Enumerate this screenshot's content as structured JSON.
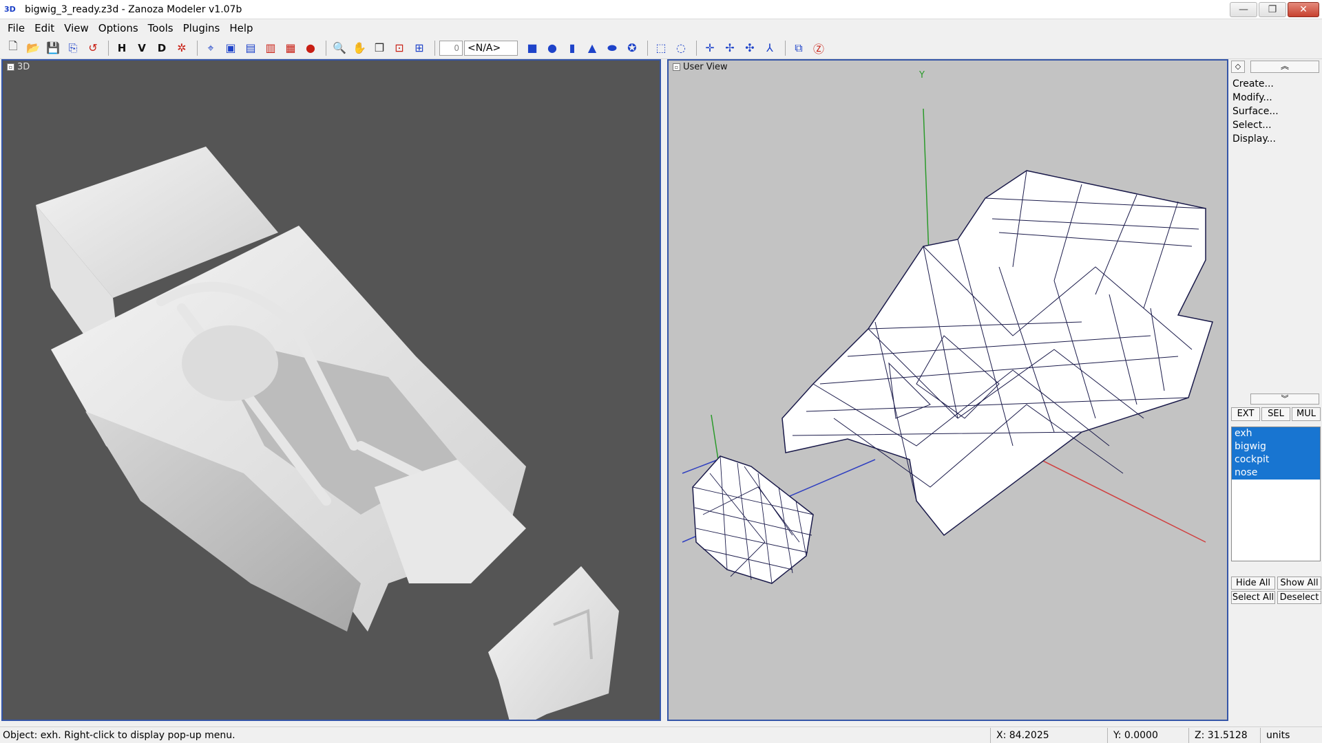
{
  "window": {
    "app_icon_text": "3D",
    "title": "bigwig_3_ready.z3d - Zanoza Modeler v1.07b",
    "buttons": {
      "minimize": "—",
      "restore": "❐",
      "close": "✕"
    }
  },
  "menubar": {
    "items": [
      "File",
      "Edit",
      "View",
      "Options",
      "Tools",
      "Plugins",
      "Help"
    ]
  },
  "toolbar": {
    "view_letters": [
      "H",
      "V",
      "D"
    ],
    "spin_value": "0",
    "combo_value": "<N/A>"
  },
  "viewports": {
    "left": {
      "label": "3D",
      "background": "#555555",
      "mode": "shaded"
    },
    "right": {
      "label": "User View",
      "background": "#c3c3c3",
      "mode": "wireframe",
      "axis_label": "Y"
    }
  },
  "right_panel": {
    "top_small": "◇",
    "top_wide": "︽",
    "menu": [
      "Create...",
      "Modify...",
      "Surface...",
      "Select...",
      "Display..."
    ],
    "scroll_down": "︾",
    "modes": [
      "EXT",
      "SEL",
      "MUL"
    ],
    "objects": [
      "exh",
      "bigwig",
      "cockpit",
      "nose"
    ],
    "actions": [
      "Hide All",
      "Show All",
      "Select All",
      "Deselect"
    ]
  },
  "statusbar": {
    "message": "Object: exh. Right-click to display pop-up menu.",
    "x": "X: 84.2025",
    "y": "Y: 0.0000",
    "z": "Z: 31.5128",
    "units": "units"
  },
  "colors": {
    "accent": "#3455a8",
    "selection": "#1875d1",
    "axis_x": "#d04040",
    "axis_y": "#2a9a2a",
    "axis_z": "#3040c0"
  }
}
